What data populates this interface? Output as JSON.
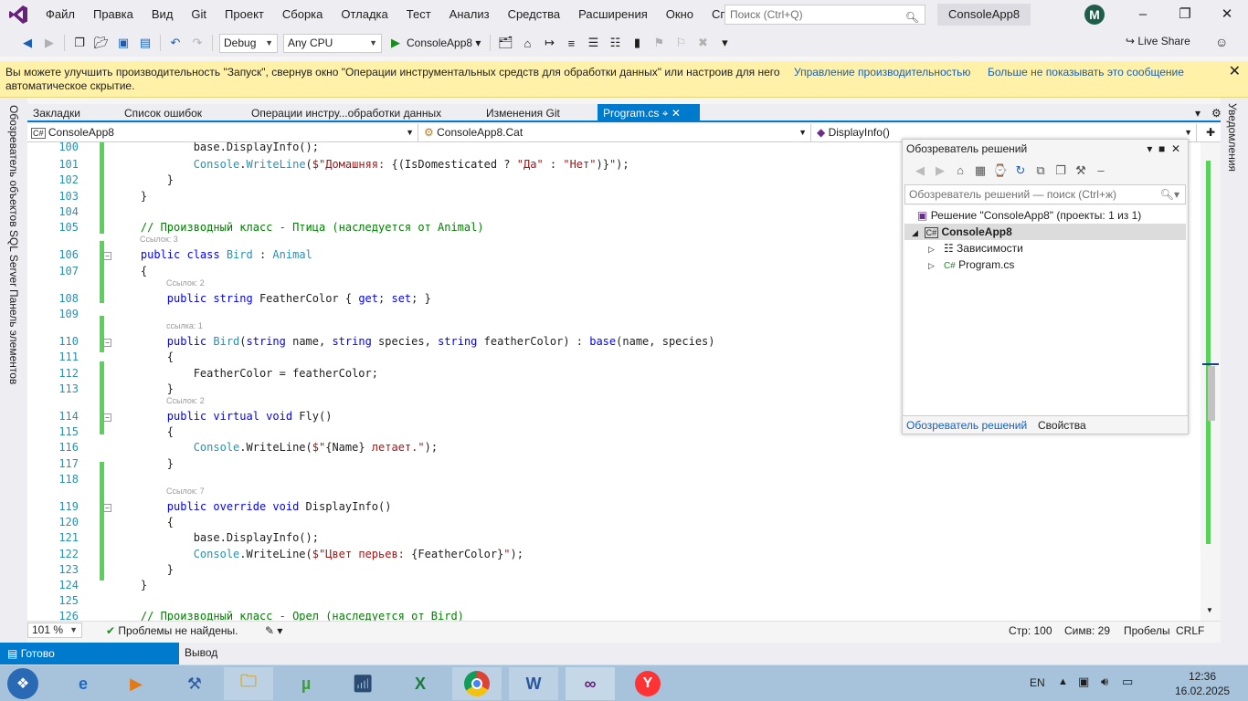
{
  "menu": {
    "items": [
      "Файл",
      "Правка",
      "Вид",
      "Git",
      "Проект",
      "Сборка",
      "Отладка",
      "Тест",
      "Анализ",
      "Средства",
      "Расширения",
      "Окно",
      "Справка"
    ],
    "search_placeholder": "Поиск (Ctrl+Q)",
    "solution_title": "ConsoleApp8",
    "avatar_letter": "M"
  },
  "toolbar": {
    "config": "Debug",
    "platform": "Any CPU",
    "run_target": "ConsoleApp8",
    "live_share": "Live Share"
  },
  "infobar": {
    "message": "Вы можете улучшить производительность \"Запуск\", свернув окно \"Операции инструментальных средств для обработки данных\" или настроив для него автоматическое скрытие.",
    "link_manage": "Управление производительностью",
    "link_dismiss": "Больше не показывать это сообщение"
  },
  "tabs": [
    "Закладки",
    "Список ошибок",
    "Операции инстру...обработки данных",
    "Изменения Git",
    "Program.cs"
  ],
  "sidebar_left": [
    "Обозреватель объектов SQL Server",
    "Панель элементов"
  ],
  "sidebar_right": "Уведомления",
  "navbar": {
    "project": "ConsoleApp8",
    "class": "ConsoleApp8.Cat",
    "member": "DisplayInfo()"
  },
  "code_lines": [
    {
      "n": "100",
      "lens": "",
      "html": "            <span>base.</span><span>DisplayInfo</span><span>();</span>"
    },
    {
      "n": "101",
      "lens": "",
      "parts": [
        [
          "",
          "            "
        ],
        [
          "ty",
          "Console"
        ],
        [
          "",
          "."
        ],
        [
          "ty",
          "WriteLine"
        ],
        [
          "",
          "("
        ],
        [
          "st",
          "$\"Домашняя: "
        ],
        [
          "",
          "{(IsDomesticated ? "
        ],
        [
          "st",
          "\"Да\""
        ],
        [
          "",
          " : "
        ],
        [
          "st",
          "\"Нет\""
        ],
        [
          "",
          ")}"
        ],
        [
          "st",
          "\""
        ],
        [
          "",
          ");"
        ]
      ]
    },
    {
      "n": "102",
      "parts": [
        [
          "",
          "        }"
        ]
      ]
    },
    {
      "n": "103",
      "parts": [
        [
          "",
          "    }"
        ]
      ]
    },
    {
      "n": "104",
      "parts": [
        [
          "",
          ""
        ]
      ]
    },
    {
      "n": "105",
      "parts": [
        [
          "cm",
          "    // Производный класс - Птица (наследуется от Animal)"
        ]
      ]
    },
    {
      "n": "106",
      "lens": "Ссылок: 3",
      "parts": [
        [
          "",
          "    "
        ],
        [
          "kw",
          "public class "
        ],
        [
          "ty",
          "Bird"
        ],
        [
          "",
          " : "
        ],
        [
          "ty",
          "Animal"
        ]
      ]
    },
    {
      "n": "107",
      "parts": [
        [
          "",
          "    {"
        ]
      ]
    },
    {
      "n": "108",
      "lens": "Ссылок: 2",
      "parts": [
        [
          "",
          "        "
        ],
        [
          "kw",
          "public string "
        ],
        [
          "",
          "FeatherColor { "
        ],
        [
          "kw",
          "get"
        ],
        [
          "",
          "; "
        ],
        [
          "kw",
          "set"
        ],
        [
          "",
          "; }"
        ]
      ]
    },
    {
      "n": "109",
      "parts": [
        [
          "",
          ""
        ]
      ]
    },
    {
      "n": "110",
      "lens": "ссылка: 1",
      "parts": [
        [
          "",
          "        "
        ],
        [
          "kw",
          "public "
        ],
        [
          "ty",
          "Bird"
        ],
        [
          "",
          "("
        ],
        [
          "kw",
          "string "
        ],
        [
          "",
          "name, "
        ],
        [
          "kw",
          "string "
        ],
        [
          "",
          "species, "
        ],
        [
          "kw",
          "string "
        ],
        [
          "",
          "featherColor) : "
        ],
        [
          "kw",
          "base"
        ],
        [
          "",
          "(name, species)"
        ]
      ]
    },
    {
      "n": "111",
      "parts": [
        [
          "",
          "        {"
        ]
      ]
    },
    {
      "n": "112",
      "parts": [
        [
          "",
          "            FeatherColor = featherColor;"
        ]
      ]
    },
    {
      "n": "113",
      "parts": [
        [
          "",
          "        }"
        ]
      ]
    },
    {
      "n": "114",
      "lens": "Ссылок: 2",
      "parts": [
        [
          "",
          "        "
        ],
        [
          "kw",
          "public virtual void "
        ],
        [
          "",
          "Fly()"
        ]
      ]
    },
    {
      "n": "115",
      "parts": [
        [
          "",
          "        {"
        ]
      ]
    },
    {
      "n": "116",
      "parts": [
        [
          "",
          "            "
        ],
        [
          "ty",
          "Console"
        ],
        [
          "",
          ".WriteLine("
        ],
        [
          "st",
          "$\""
        ],
        [
          "",
          "{Name}"
        ],
        [
          "st",
          " летает.\""
        ],
        [
          "",
          ");"
        ]
      ]
    },
    {
      "n": "117",
      "parts": [
        [
          "",
          "        }"
        ]
      ]
    },
    {
      "n": "118",
      "parts": [
        [
          "",
          ""
        ]
      ]
    },
    {
      "n": "119",
      "lens": "Ссылок: 7",
      "parts": [
        [
          "",
          "        "
        ],
        [
          "kw",
          "public override void "
        ],
        [
          "",
          "DisplayInfo()"
        ]
      ]
    },
    {
      "n": "120",
      "parts": [
        [
          "",
          "        {"
        ]
      ]
    },
    {
      "n": "121",
      "parts": [
        [
          "",
          "            base.DisplayInfo();"
        ]
      ]
    },
    {
      "n": "122",
      "parts": [
        [
          "",
          "            "
        ],
        [
          "ty",
          "Console"
        ],
        [
          "",
          ".WriteLine("
        ],
        [
          "st",
          "$\"Цвет перьев: "
        ],
        [
          "",
          "{FeatherColor}"
        ],
        [
          "st",
          "\""
        ],
        [
          "",
          ");"
        ]
      ]
    },
    {
      "n": "123",
      "parts": [
        [
          "",
          "        }"
        ]
      ]
    },
    {
      "n": "124",
      "parts": [
        [
          "",
          "    }"
        ]
      ]
    },
    {
      "n": "125",
      "parts": [
        [
          "",
          ""
        ]
      ]
    },
    {
      "n": "126",
      "parts": [
        [
          "cm",
          "    // Производный класс - Орел (наследуется от Bird)"
        ]
      ]
    }
  ],
  "solution_explorer": {
    "title": "Обозреватель решений",
    "search_placeholder": "Обозреватель решений — поиск (Ctrl+ж)",
    "solution": "Решение \"ConsoleApp8\" (проекты: 1 из 1)",
    "project": "ConsoleApp8",
    "deps": "Зависимости",
    "file": "Program.cs",
    "tab_explorer": "Обозреватель решений",
    "tab_props": "Свойства"
  },
  "status": {
    "zoom": "101 %",
    "problems": "Проблемы не найдены.",
    "line": "Стр: 100",
    "col": "Симв: 29",
    "spaces": "Пробелы",
    "eol": "CRLF",
    "ready": "Готово",
    "output": "Вывод"
  },
  "taskbar": {
    "lang": "EN",
    "time": "12:36",
    "date": "16.02.2025"
  }
}
